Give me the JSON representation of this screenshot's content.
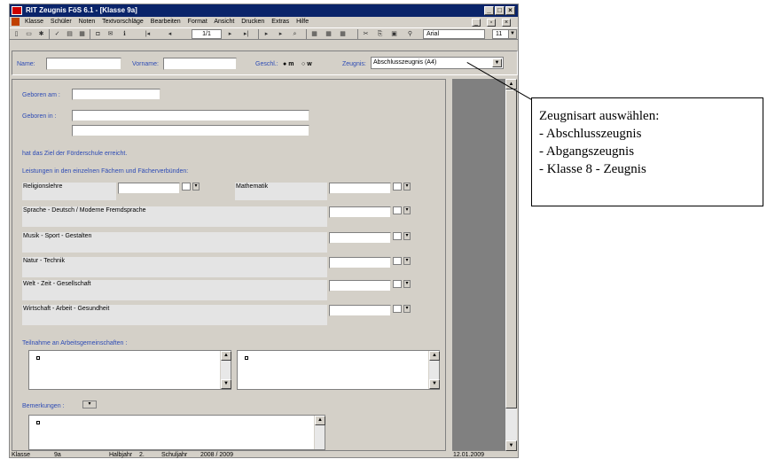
{
  "app": {
    "title": "RIT Zeugnis FöS 6.1 - [Klasse 9a]",
    "menu": [
      "Klasse",
      "Schüler",
      "Noten",
      "Textvorschläge",
      "Bearbeiten",
      "Format",
      "Ansicht",
      "Drucken",
      "Extras",
      "Hilfe"
    ],
    "page": "1/1",
    "font": "Arial",
    "fontsize": "11"
  },
  "header": {
    "name_label": "Name:",
    "vorname_label": "Vorname:",
    "geschl_label": "Geschl.:",
    "m": "m",
    "w": "w",
    "zeugnis_label": "Zeugnis:",
    "zeugnis_value": "Abschlusszeugnis (A4)"
  },
  "form": {
    "geboren_am": "Geboren am :",
    "geboren_in": "Geboren in :",
    "ziel": "hat das Ziel der Förderschule erreicht.",
    "leistungen": "Leistungen in den einzelnen Fächern und Fächerverbünden:",
    "subjects": [
      "Religionslehre",
      "Mathematik",
      "Sprache - Deutsch / Moderne Fremdsprache",
      "Musik - Sport - Gestalten",
      "Natur - Technik",
      "Welt - Zeit - Gesellschaft",
      "Wirtschaft - Arbeit - Gesundheit"
    ],
    "teilnahme": "Teilnahme an Arbeitsgemeinschaften :",
    "bemerkungen": "Bemerkungen :"
  },
  "status": {
    "klasse_label": "Klasse",
    "klasse": "9a",
    "halbjahr_label": "Halbjahr",
    "halbjahr": "2.",
    "schuljahr_label": "Schuljahr",
    "schuljahr": "2008 / 2009",
    "date": "12.01.2009"
  },
  "callout": {
    "title": "Zeugnisart auswählen:",
    "items": [
      "- Abschlusszeugnis",
      "- Abgangszeugnis",
      "- Klasse 8 - Zeugnis"
    ]
  }
}
